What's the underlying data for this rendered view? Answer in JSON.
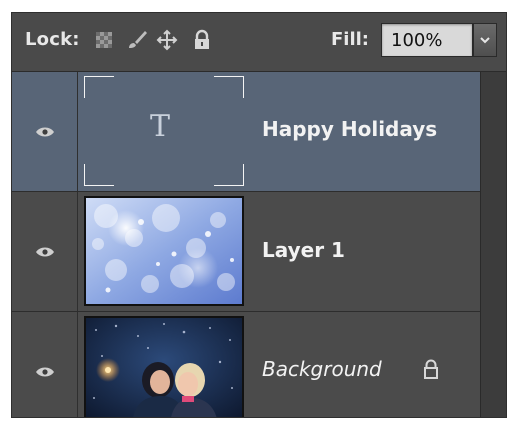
{
  "lockbar": {
    "lock_label": "Lock:",
    "icons": [
      "lock-transparent-pixels-icon",
      "lock-image-pixels-brush-icon",
      "lock-position-move-icon",
      "lock-all-padlock-icon"
    ],
    "fill_label": "Fill:",
    "fill_value": "100%"
  },
  "layers": [
    {
      "name": "Happy Holidays",
      "type": "text",
      "selected": true,
      "visible": true,
      "thumb_glyph": "T"
    },
    {
      "name": "Layer 1",
      "type": "pixel",
      "selected": false,
      "visible": true
    },
    {
      "name": "Background",
      "type": "pixel",
      "selected": false,
      "visible": true,
      "locked": true
    }
  ],
  "colors": {
    "panel_bg": "#474747",
    "selected_bg": "#586577",
    "text": "#f2f2f2"
  }
}
